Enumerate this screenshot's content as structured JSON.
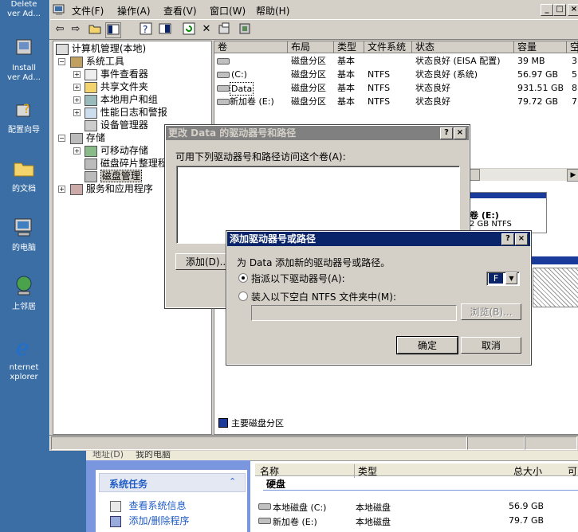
{
  "desktop": {
    "icons": [
      {
        "label": "Delete\nver Ad..."
      },
      {
        "label": "Install\nver Ad..."
      },
      {
        "label": "配置向导"
      },
      {
        "label": "的文档"
      },
      {
        "label": "的电脑"
      },
      {
        "label": "上邻居"
      },
      {
        "label": "nternet\nxplorer"
      }
    ]
  },
  "mmc": {
    "menu": [
      "文件(F)",
      "操作(A)",
      "查看(V)",
      "窗口(W)",
      "帮助(H)"
    ],
    "window_buttons": [
      "_",
      "□",
      "×"
    ],
    "tree": {
      "root": "计算机管理(本地)",
      "items": [
        {
          "label": "系统工具"
        },
        {
          "label": "事件查看器"
        },
        {
          "label": "共享文件夹"
        },
        {
          "label": "本地用户和组"
        },
        {
          "label": "性能日志和警报"
        },
        {
          "label": "设备管理器"
        },
        {
          "label": "存储"
        },
        {
          "label": "可移动存储"
        },
        {
          "label": "磁盘碎片整理程序"
        },
        {
          "label": "磁盘管理"
        },
        {
          "label": "服务和应用程序"
        }
      ]
    },
    "columns": [
      "卷",
      "布局",
      "类型",
      "文件系统",
      "状态",
      "容量",
      "空"
    ],
    "volumes": [
      {
        "vol": "",
        "layout": "磁盘分区",
        "type": "基本",
        "fs": "",
        "status": "状态良好 (EISA 配置)",
        "cap": "39 MB",
        "free": "3"
      },
      {
        "vol": "(C:)",
        "layout": "磁盘分区",
        "type": "基本",
        "fs": "NTFS",
        "status": "状态良好 (系统)",
        "cap": "56.97 GB",
        "free": "5"
      },
      {
        "vol": "Data",
        "layout": "磁盘分区",
        "type": "基本",
        "fs": "NTFS",
        "status": "状态良好",
        "cap": "931.51 GB",
        "free": "8"
      },
      {
        "vol": "新加卷 (E:)",
        "layout": "磁盘分区",
        "type": "基本",
        "fs": "NTFS",
        "status": "状态良好",
        "cap": "79.72 GB",
        "free": "7"
      }
    ],
    "graph_partition": {
      "name": "卷 (E:)",
      "detail": "2 GB NTFS"
    },
    "legend": "主要磁盘分区"
  },
  "dialog_change": {
    "title": "更改 Data 的驱动器号和路径",
    "prompt": "可用下列驱动器号和路径访问这个卷(A):",
    "add_button": "添加(D)..."
  },
  "dialog_add": {
    "title": "添加驱动器号或路径",
    "prompt": "为 Data 添加新的驱动器号或路径。",
    "option_letter": "指派以下驱动器号(A):",
    "selected_letter": "F",
    "option_folder": "装入以下空白 NTFS 文件夹中(M):",
    "browse_button": "浏览(B)...",
    "ok_button": "确定",
    "cancel_button": "取消"
  },
  "explorer": {
    "address_label": "地址(D)",
    "address_value": "我的电脑",
    "task_title": "系统任务",
    "tasks": [
      "查看系统信息",
      "添加/删除程序"
    ],
    "columns": [
      "名称",
      "类型",
      "总大小",
      "可"
    ],
    "group": "硬盘",
    "rows": [
      {
        "name": "本地磁盘 (C:)",
        "type": "本地磁盘",
        "size": "56.9 GB"
      },
      {
        "name": "新加卷 (E:)",
        "type": "本地磁盘",
        "size": "79.7 GB"
      }
    ]
  }
}
